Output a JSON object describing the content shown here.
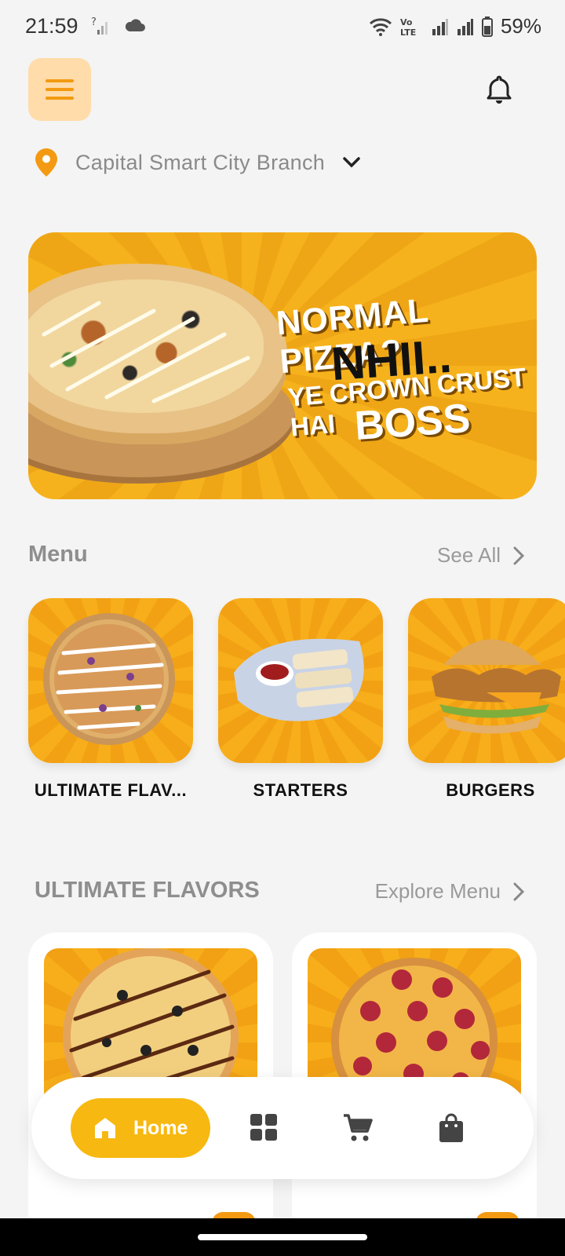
{
  "status_bar": {
    "time": "21:59",
    "battery": "59%",
    "volte": "Vo LTE"
  },
  "header": {
    "menu_icon": "hamburger-icon",
    "bell_icon": "bell-icon"
  },
  "branch": {
    "icon": "location-pin-icon",
    "label": "Capital Smart City Branch",
    "dropdown_icon": "chevron-down-icon"
  },
  "banner": {
    "line1": "NORMAL PIZZA?",
    "line2": "NHII..",
    "line3": "YE CROWN CRUST HAI",
    "line4": "BOSS"
  },
  "menu_section": {
    "title": "Menu",
    "see_all": "See All",
    "categories": [
      {
        "name": "ULTIMATE FLAV..."
      },
      {
        "name": "STARTERS"
      },
      {
        "name": "BURGERS"
      }
    ]
  },
  "flavors_section": {
    "title": "ULTIMATE FLAVORS",
    "explore": "Explore Menu"
  },
  "bottom_nav": {
    "home_label": "Home",
    "items": [
      "home-icon",
      "grid-icon",
      "cart-icon",
      "bag-icon"
    ]
  },
  "colors": {
    "accent": "#f39a12",
    "nav_active": "#f7b811",
    "background": "#f4f4f4"
  }
}
